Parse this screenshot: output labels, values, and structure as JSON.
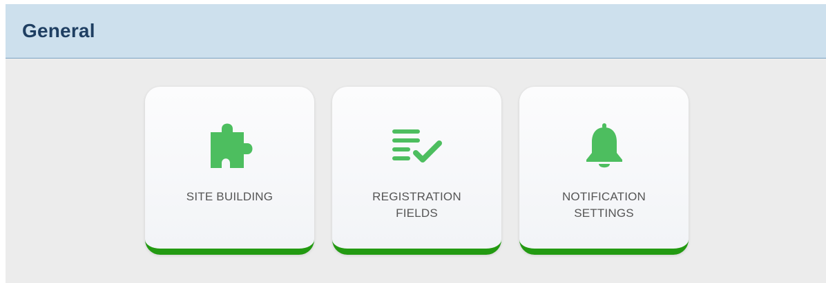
{
  "panel": {
    "title": "General"
  },
  "tiles": [
    {
      "icon": "puzzle-piece-icon",
      "label_lines": [
        "SITE BUILDING"
      ]
    },
    {
      "icon": "list-check-icon",
      "label_lines": [
        "REGISTRATION",
        "FIELDS"
      ]
    },
    {
      "icon": "bell-icon",
      "label_lines": [
        "NOTIFICATION",
        "SETTINGS"
      ]
    }
  ],
  "colors": {
    "header_bg": "#cde0ed",
    "header_text": "#1f3f62",
    "panel_bg": "#ececec",
    "icon_green": "#4dbe5f",
    "accent_bar": "#239a12",
    "label_text": "#555555"
  }
}
